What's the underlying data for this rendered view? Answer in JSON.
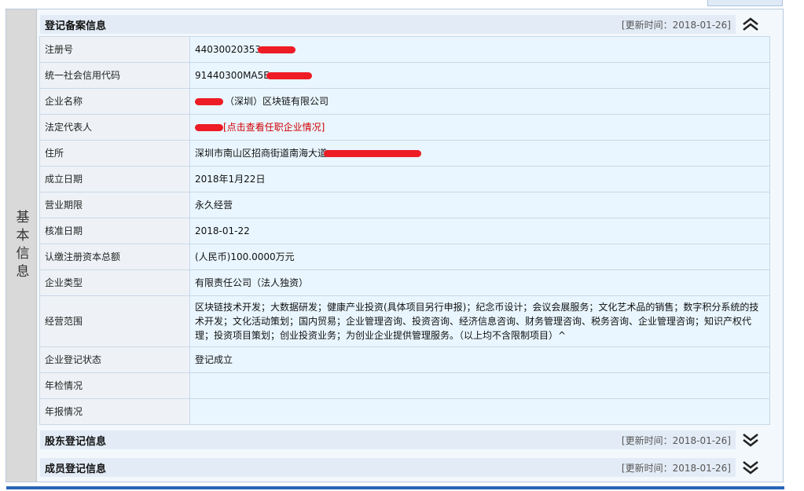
{
  "section_basic": {
    "side_label": "基本信息",
    "title": "登记备案信息",
    "updated": "[更新时间：2018-01-26]"
  },
  "rows": [
    {
      "label": "注册号",
      "value": "44030020353"
    },
    {
      "label": "统一社会信用代码",
      "value": "91440300MA5E"
    },
    {
      "label": "企业名称",
      "value": "（深圳）区块链有限公司"
    },
    {
      "label": "法定代表人",
      "value": "",
      "link": "[点击查看任职企业情况]"
    },
    {
      "label": "住所",
      "value": "深圳市南山区招商街道南海大道"
    },
    {
      "label": "成立日期",
      "value": "2018年1月22日"
    },
    {
      "label": "营业期限",
      "value": "永久经营"
    },
    {
      "label": "核准日期",
      "value": "2018-01-22"
    },
    {
      "label": "认缴注册资本总额",
      "value": "(人民币)100.0000万元"
    },
    {
      "label": "企业类型",
      "value": "有限责任公司（法人独资）"
    },
    {
      "label": "经营范围",
      "value": "区块链技术开发；大数据研发；健康产业投资(具体项目另行申报)；纪念币设计；会议会展服务；文化艺术品的销售；数字积分系统的技术开发；文化活动策划；国内贸易；企业管理咨询、投资咨询、经济信息咨询、财务管理咨询、税务咨询、企业管理咨询；知识产权代理；投资项目策划；创业投资业务；为创业企业提供管理服务。（以上均不含限制项目）^"
    },
    {
      "label": "企业登记状态",
      "value": "登记成立"
    },
    {
      "label": "年检情况",
      "value": ""
    },
    {
      "label": "年报情况",
      "value": ""
    }
  ],
  "section_shareholder": {
    "title": "股东登记信息",
    "updated": "[更新时间：2018-01-26]"
  },
  "section_member": {
    "title": "成员登记信息",
    "updated": "[更新时间：2018-01-26]"
  },
  "icons": {
    "collapse": "chevron-double-up-icon",
    "expand": "chevron-double-down-icon"
  },
  "colors": {
    "header_bg": "#e3ecf6",
    "value_bg": "#e9f6ff",
    "label_bg": "#eef2f6",
    "link_red": "#d10000",
    "bottom_bar": "#2866b7"
  }
}
